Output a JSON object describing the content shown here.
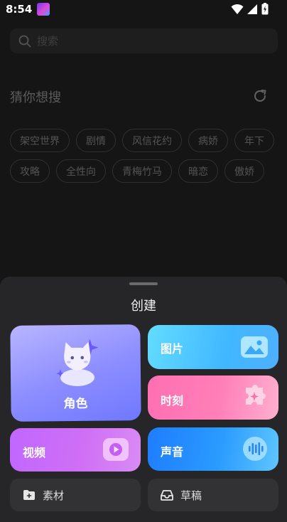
{
  "status": {
    "time": "8:54"
  },
  "search": {
    "placeholder": "搜索"
  },
  "guess": {
    "title": "猜你想搜"
  },
  "tags": {
    "row1": [
      "架空世界",
      "剧情",
      "风信花约",
      "病娇",
      "年下"
    ],
    "row2": [
      "攻略",
      "全性向",
      "青梅竹马",
      "暗恋",
      "傲娇"
    ]
  },
  "sheet": {
    "title": "创建",
    "role_label": "角色",
    "image_label": "图片",
    "moment_label": "时刻",
    "video_label": "视频",
    "voice_label": "声音",
    "material_label": "素材",
    "draft_label": "草稿"
  }
}
